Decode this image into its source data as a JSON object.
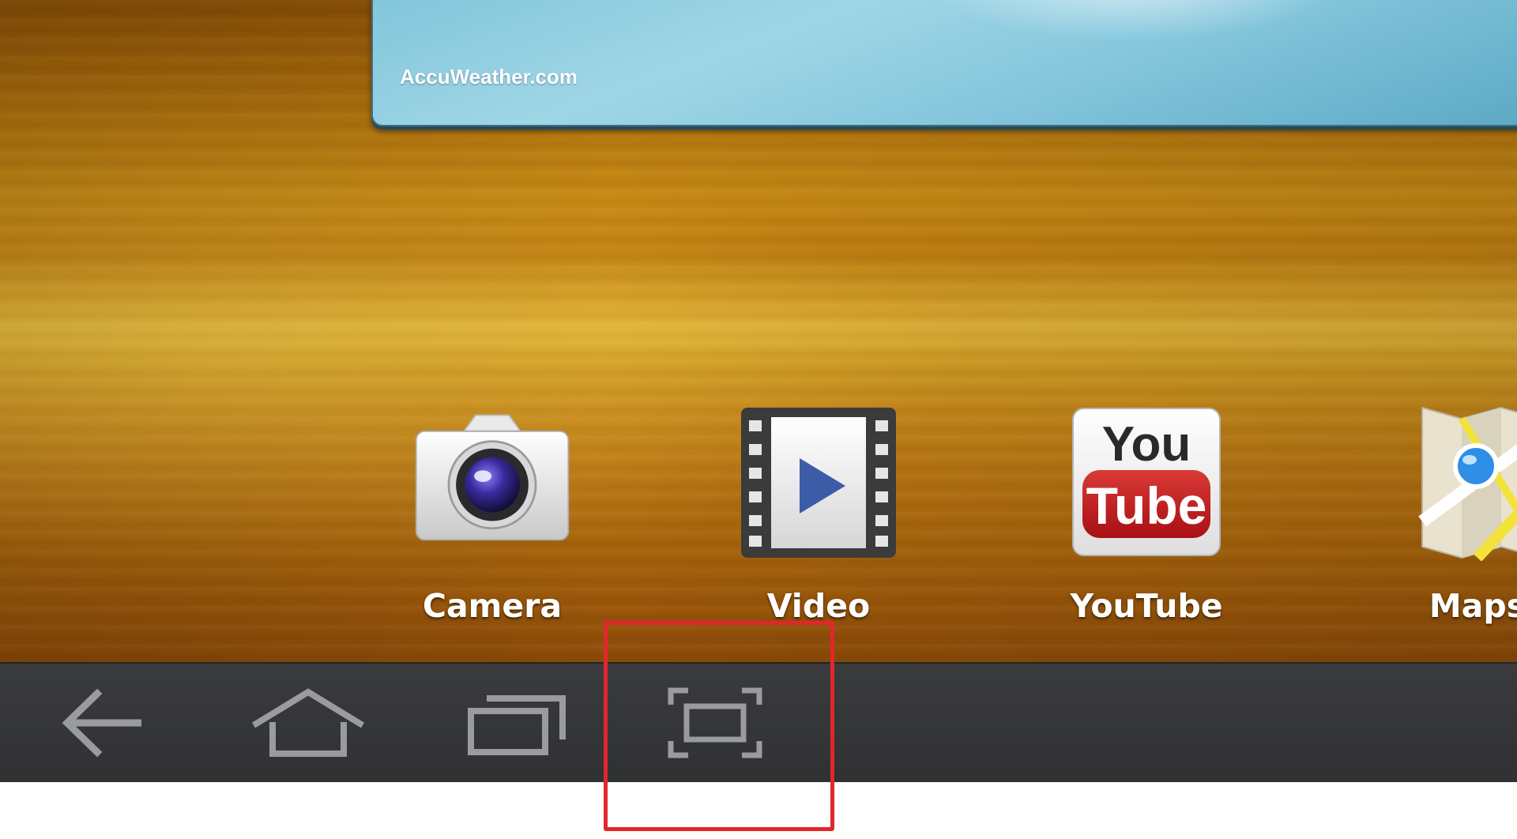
{
  "weather_widget": {
    "provider": "AccuWeather.com"
  },
  "apps": [
    {
      "label": "Camera",
      "icon": "camera-icon"
    },
    {
      "label": "Video",
      "icon": "video-icon"
    },
    {
      "label": "YouTube",
      "icon": "youtube-icon"
    },
    {
      "label": "Maps",
      "icon": "maps-icon"
    }
  ],
  "youtube_logo": {
    "top": "You",
    "bottom": "Tube"
  },
  "navbar": {
    "buttons": [
      {
        "name": "back",
        "icon": "back-arrow-icon"
      },
      {
        "name": "home",
        "icon": "home-icon"
      },
      {
        "name": "recent-apps",
        "icon": "recent-apps-icon"
      },
      {
        "name": "screenshot",
        "icon": "screenshot-icon"
      }
    ]
  },
  "highlight": {
    "target": "screenshot",
    "color": "#e3262d"
  }
}
